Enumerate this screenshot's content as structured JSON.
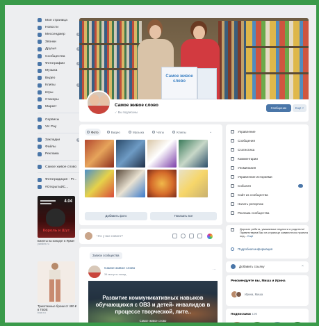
{
  "nav": {
    "items": [
      {
        "label": "Моя страница",
        "badge": ""
      },
      {
        "label": "Новости",
        "badge": ""
      },
      {
        "label": "Мессенджер",
        "badge": "3"
      },
      {
        "label": "Звонки",
        "badge": ""
      },
      {
        "label": "Друзья",
        "badge": "4"
      },
      {
        "label": "Сообщества",
        "badge": ""
      },
      {
        "label": "Фотографии",
        "badge": "2"
      },
      {
        "label": "Музыка",
        "badge": ""
      },
      {
        "label": "Видео",
        "badge": ""
      },
      {
        "label": "Клипы",
        "badge": "1"
      },
      {
        "label": "Игры",
        "badge": ""
      },
      {
        "label": "Стикеры",
        "badge": ""
      },
      {
        "label": "Маркет",
        "badge": ""
      }
    ],
    "items2": [
      {
        "label": "Сервисы"
      },
      {
        "label": "VK Pay"
      }
    ],
    "items3": [
      {
        "label": "Закладки",
        "badge": "6"
      },
      {
        "label": "Файлы",
        "badge": ""
      },
      {
        "label": "Реклама",
        "badge": ""
      }
    ],
    "items4": [
      {
        "label": "Самое живое слово"
      }
    ],
    "items5": [
      {
        "label": "Фотоградиция - Pr..."
      },
      {
        "label": "#ОткрытыйС..."
      }
    ]
  },
  "ads": [
    {
      "title": "Билеты на концерт в Ярме!",
      "sub": "yandex.ru",
      "poster_text": "Король и Шут",
      "poster_date": "4.04"
    },
    {
      "title": "Трикотажные брюки от 490 ₽ в ТВОЕ",
      "sub": "tvoe.ru"
    }
  ],
  "group": {
    "name": "Самое живое слово",
    "subscribed": "Вы подписаны",
    "message_button": "Сообщение",
    "more_button": "Ещё",
    "cover_sign": "Самое живое слово"
  },
  "media_tabs": [
    "Фото",
    "Видео",
    "Музыка",
    "Чаты",
    "Клипы"
  ],
  "photo_buttons": {
    "add": "Добавить фото",
    "all": "Показать все"
  },
  "composer": {
    "placeholder": "Что у вас нового?"
  },
  "feed": {
    "section": "Записи сообщества",
    "post_author": "Самое живое слово",
    "post_time": "34 минуты назад",
    "banner_title": "Развитие коммуникативных навыков обучающихся с ОВЗ и детей- инвалидов в процессе творческой, лите..",
    "banner_sub": "Самое живое слово"
  },
  "right_menu": [
    {
      "label": "Управление",
      "badge": false
    },
    {
      "label": "Сообщения",
      "badge": false
    },
    {
      "label": "Статистика",
      "badge": false
    },
    {
      "label": "Комментарии",
      "badge": false
    },
    {
      "label": "Упоминания",
      "badge": false
    },
    {
      "label": "Управление историями",
      "badge": false
    },
    {
      "label": "События",
      "badge": true
    },
    {
      "label": "Сайт из сообщества",
      "badge": false
    },
    {
      "label": "Начать репортаж",
      "badge": false
    },
    {
      "label": "Реклама сообщества",
      "badge": false
    }
  ],
  "about": {
    "text": "Дорогие ребята, уважаемые педагоги и родители! Приветствуем Вас на странице совместного проекта пед...",
    "more": "Ещё",
    "details": "Подробная информация"
  },
  "invite": "Добавить ссылку",
  "recommend": {
    "title": "Рекомендуете вы, Миша и Ирина",
    "names": "Ирина, Миша"
  },
  "subscribers": {
    "title": "Подписчики",
    "count": "100"
  },
  "colors": {
    "accent": "#4a76a8",
    "frame": "#3a9a4a"
  }
}
